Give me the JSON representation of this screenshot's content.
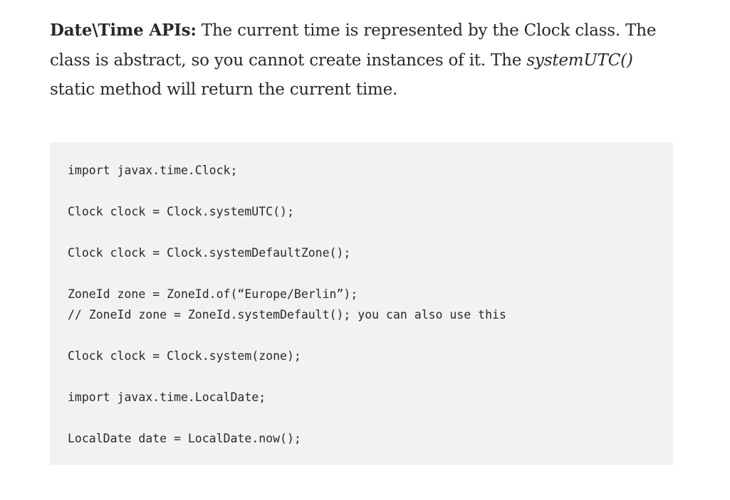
{
  "paragraph": {
    "bold_lead": "Date\\Time APIs:",
    "text_part1": " The current time is represented by the Clock class. The class is abstract, so you cannot create instances of it. The ",
    "emphasis": "systemUTC()",
    "text_part2": " static method will return the current time."
  },
  "code": {
    "lines": [
      "import javax.time.Clock;",
      "",
      "Clock clock = Clock.systemUTC();",
      "",
      "Clock clock = Clock.systemDefaultZone();",
      "",
      "ZoneId zone = ZoneId.of(“Europe/Berlin”);",
      "// ZoneId zone = ZoneId.systemDefault(); you can also use this",
      "",
      "Clock clock = Clock.system(zone);",
      "",
      "import javax.time.LocalDate;",
      "",
      "LocalDate date = LocalDate.now();"
    ]
  }
}
